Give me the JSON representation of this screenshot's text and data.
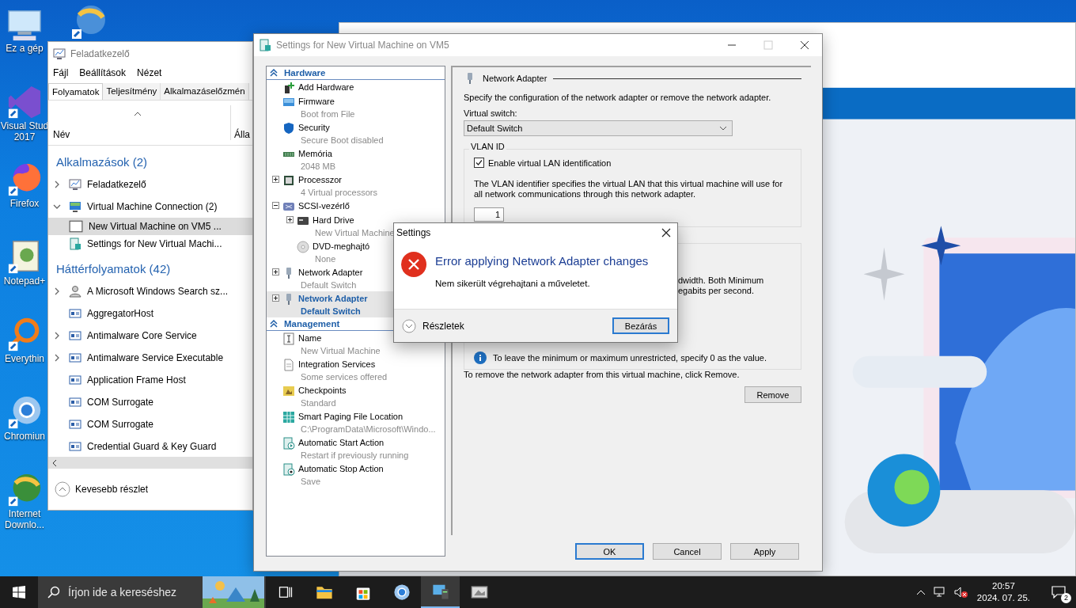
{
  "desktop_icons": [
    {
      "kind": "computer",
      "lines": [
        "Ez a gép"
      ]
    },
    {
      "kind": "visual-studio",
      "lines": [
        "Visual Stud",
        "2017"
      ]
    },
    {
      "kind": "firefox",
      "lines": [
        "Firefox"
      ]
    },
    {
      "kind": "notepad",
      "lines": [
        "Notepad+"
      ]
    },
    {
      "kind": "everything",
      "lines": [
        "Everythin"
      ]
    },
    {
      "kind": "chromium",
      "lines": [
        "Chromiun"
      ]
    },
    {
      "kind": "download",
      "lines": [
        "Internet",
        "Downlo..."
      ]
    }
  ],
  "task_manager": {
    "title": "Feladatkezelő",
    "menu": [
      "Fájl",
      "Beállítások",
      "Nézet"
    ],
    "tabs": [
      {
        "label": "Folyamatok",
        "selected": true
      },
      {
        "label": "Teljesítmény",
        "selected": false
      },
      {
        "label": "Alkalmazáselőzmén",
        "selected": false
      }
    ],
    "columns": [
      "Név",
      "Álla"
    ],
    "groups": [
      {
        "heading": "Alkalmazások (2)",
        "rows": [
          {
            "name": "Feladatkezelő",
            "kind": "taskmgr",
            "expanded": false,
            "selected": false
          },
          {
            "name": "Virtual Machine Connection (2)",
            "kind": "vmconnect",
            "expanded": true,
            "selected": false,
            "children": [
              {
                "name": "New Virtual Machine on VM5 ...",
                "kind": "window",
                "selected": true
              },
              {
                "name": "Settings for New Virtual Machi...",
                "kind": "settings",
                "selected": false
              }
            ]
          }
        ]
      },
      {
        "heading": "Háttérfolyamatok (42)",
        "rows": [
          {
            "name": "A Microsoft Windows Search sz...",
            "kind": "search",
            "expanded": false,
            "selected": false
          },
          {
            "name": "AggregatorHost",
            "kind": "service",
            "selected": false
          },
          {
            "name": "Antimalware Core Service",
            "kind": "service",
            "expanded": false,
            "selected": false
          },
          {
            "name": "Antimalware Service Executable",
            "kind": "service",
            "expanded": false,
            "selected": false
          },
          {
            "name": "Application Frame Host",
            "kind": "service",
            "selected": false
          },
          {
            "name": "COM Surrogate",
            "kind": "service",
            "selected": false
          },
          {
            "name": "COM Surrogate",
            "kind": "service",
            "selected": false
          },
          {
            "name": "Credential Guard & Key Guard",
            "kind": "service",
            "selected": false
          }
        ]
      }
    ],
    "footer": "Kevesebb részlet"
  },
  "settings": {
    "title": "Settings for New Virtual Machine on VM5",
    "sections": [
      {
        "heading": "Hardware",
        "items": [
          {
            "label": "Add Hardware",
            "kind": "hardware",
            "selected": false
          },
          {
            "label": "Firmware",
            "detail": "Boot from File",
            "kind": "firmware",
            "selected": false
          },
          {
            "label": "Security",
            "detail": "Secure Boot disabled",
            "kind": "security",
            "selected": false
          },
          {
            "label": "Memória",
            "detail": "2048 MB",
            "kind": "memory",
            "selected": false
          },
          {
            "label": "Processzor",
            "detail": "4 Virtual processors",
            "kind": "processor",
            "expanded": false,
            "selected": false
          },
          {
            "label": "SCSI-vezérlő",
            "kind": "scsi",
            "expanded": true,
            "selected": false,
            "children": [
              {
                "label": "Hard Drive",
                "detail": "New Virtual Machine",
                "kind": "disk",
                "expanded": false,
                "selected": false
              },
              {
                "label": "DVD-meghajtó",
                "detail": "None",
                "kind": "dvd",
                "selected": false
              }
            ]
          },
          {
            "label": "Network Adapter",
            "detail": "Default Switch",
            "kind": "network",
            "expanded": false,
            "selected": false
          },
          {
            "label": "Network Adapter",
            "detail": "Default Switch",
            "kind": "network",
            "expanded": false,
            "selected": true
          }
        ]
      },
      {
        "heading": "Management",
        "items": [
          {
            "label": "Name",
            "detail": "New Virtual Machine",
            "kind": "name",
            "selected": false
          },
          {
            "label": "Integration Services",
            "detail": "Some services offered",
            "kind": "integration",
            "selected": false
          },
          {
            "label": "Checkpoints",
            "detail": "Standard",
            "kind": "checkpoint",
            "selected": false
          },
          {
            "label": "Smart Paging File Location",
            "detail": "C:\\ProgramData\\Microsoft\\Windo...",
            "kind": "paging",
            "selected": false
          },
          {
            "label": "Automatic Start Action",
            "detail": "Restart if previously running",
            "kind": "start",
            "selected": false
          },
          {
            "label": "Automatic Stop Action",
            "detail": "Save",
            "kind": "stop",
            "selected": false
          }
        ]
      }
    ],
    "panel": {
      "heading": "Network Adapter",
      "intro": "Specify the configuration of the network adapter or remove the network adapter.",
      "switch_label": "Virtual switch:",
      "switch_value": "Default Switch",
      "vlan": {
        "legend": "VLAN ID",
        "checkbox": {
          "label": "Enable virtual LAN identification",
          "checked": true
        },
        "description": "The VLAN identifier specifies the virtual LAN that this virtual machine will use for all network communications through this network adapter.",
        "value": "1"
      },
      "bandwidth": {
        "fragments": [
          "dwidth. Both Minimum",
          "egabits per second."
        ],
        "info": "To leave the minimum or maximum unrestricted, specify 0 as the value."
      },
      "remove_note": "To remove the network adapter from this virtual machine, click Remove.",
      "remove_button": "Remove"
    },
    "buttons": [
      {
        "label": "OK",
        "focused": true
      },
      {
        "label": "Cancel",
        "focused": false
      },
      {
        "label": "Apply",
        "focused": false
      }
    ]
  },
  "dialog": {
    "title": "Settings",
    "heading": "Error applying Network Adapter changes",
    "message": "Nem sikerült végrehajtani a műveletet.",
    "details": "Részletek",
    "button": "Bezárás"
  },
  "taskbar": {
    "search_placeholder": "Írjon ide a kereséshez",
    "apps": [
      {
        "kind": "task-view",
        "active": false
      },
      {
        "kind": "explorer",
        "active": false
      },
      {
        "kind": "store",
        "active": false
      },
      {
        "kind": "chromium",
        "active": false
      },
      {
        "kind": "hyperv",
        "active": true
      },
      {
        "kind": "vmconnect",
        "active": false
      }
    ],
    "time": "20:57",
    "date": "2024. 07. 25.",
    "notifications": "2"
  }
}
